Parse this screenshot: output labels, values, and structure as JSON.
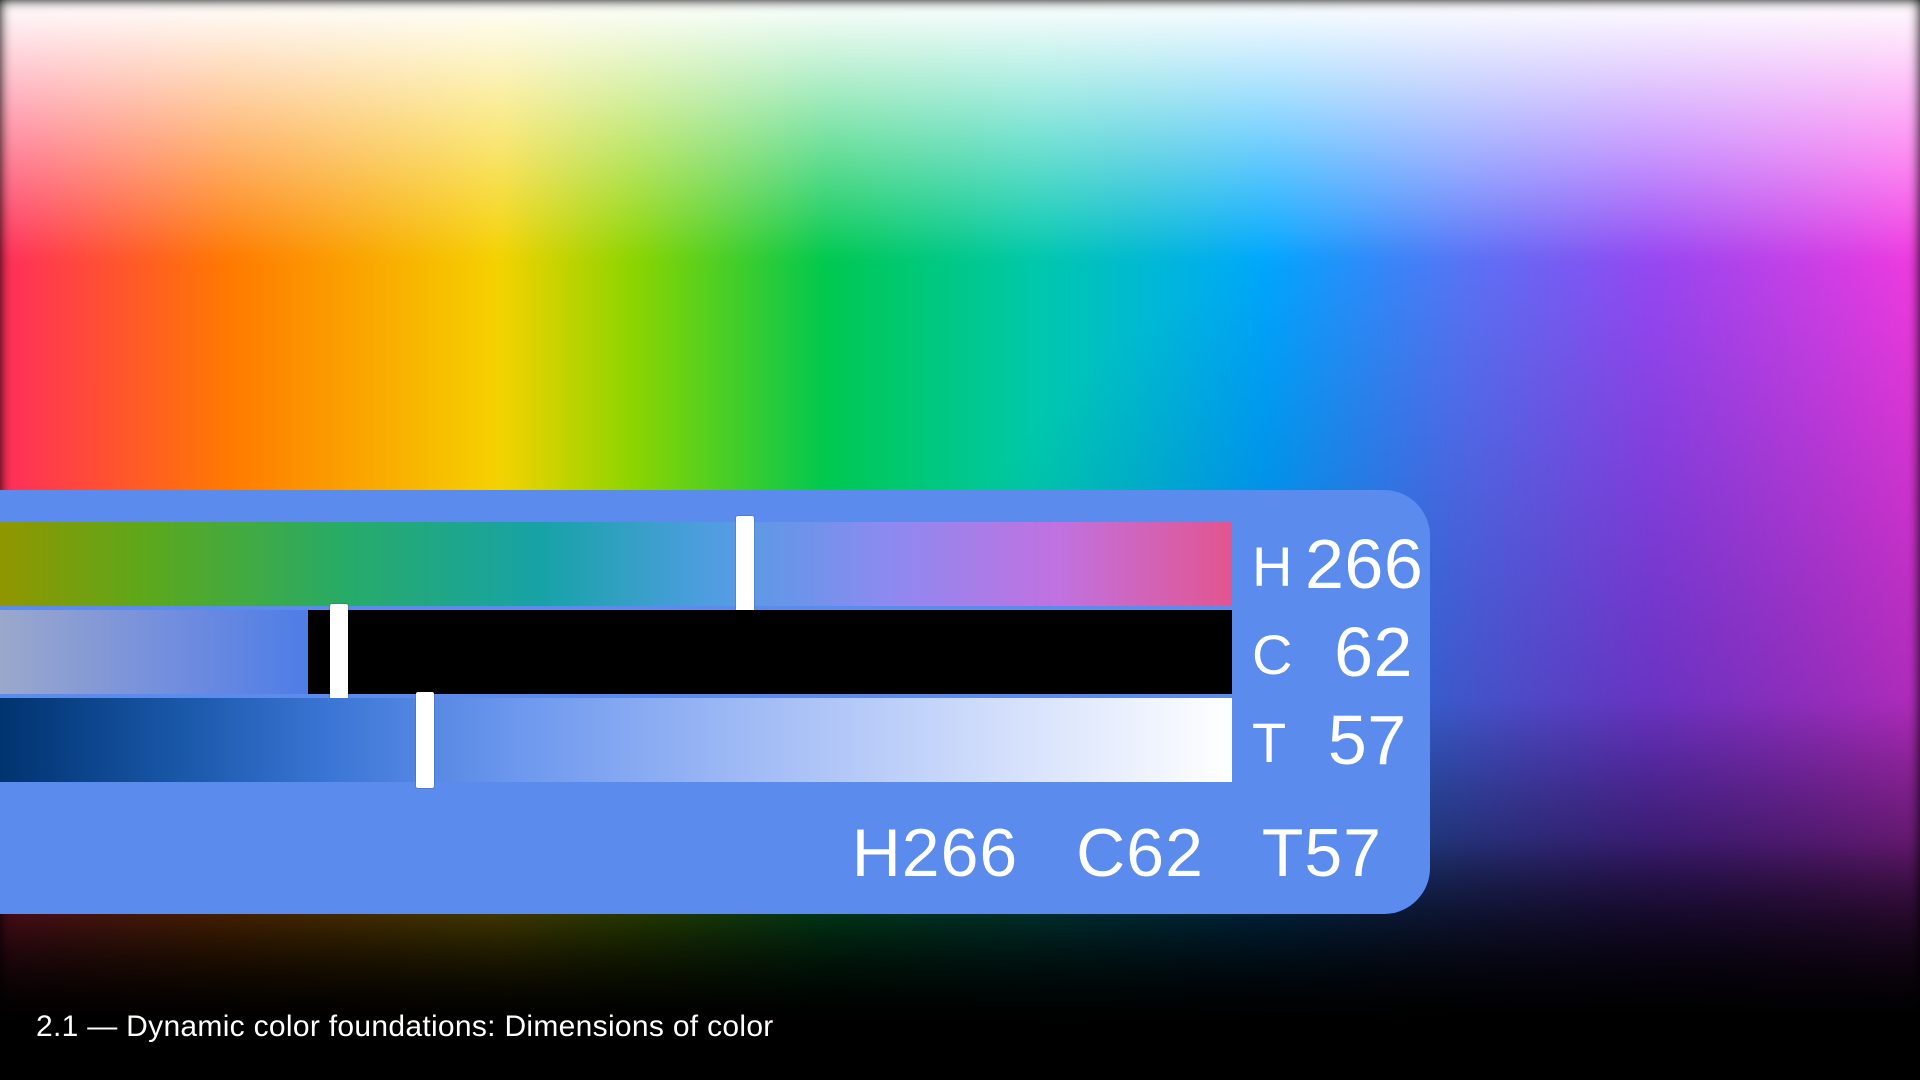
{
  "panel": {
    "background": "#5b8bec",
    "sliders": {
      "hue": {
        "key": "H",
        "value": 266,
        "max": 360,
        "thumb_pct": 60.5
      },
      "chroma": {
        "key": "C",
        "value": 62,
        "max": 128,
        "thumb_pct": 27.5
      },
      "tone": {
        "key": "T",
        "value": 57,
        "max": 100,
        "thumb_pct": 34.5
      }
    },
    "summary": {
      "h": "H266",
      "c": "C62",
      "t": "T57"
    }
  },
  "caption": "2.1 — Dynamic color foundations: Dimensions of color"
}
